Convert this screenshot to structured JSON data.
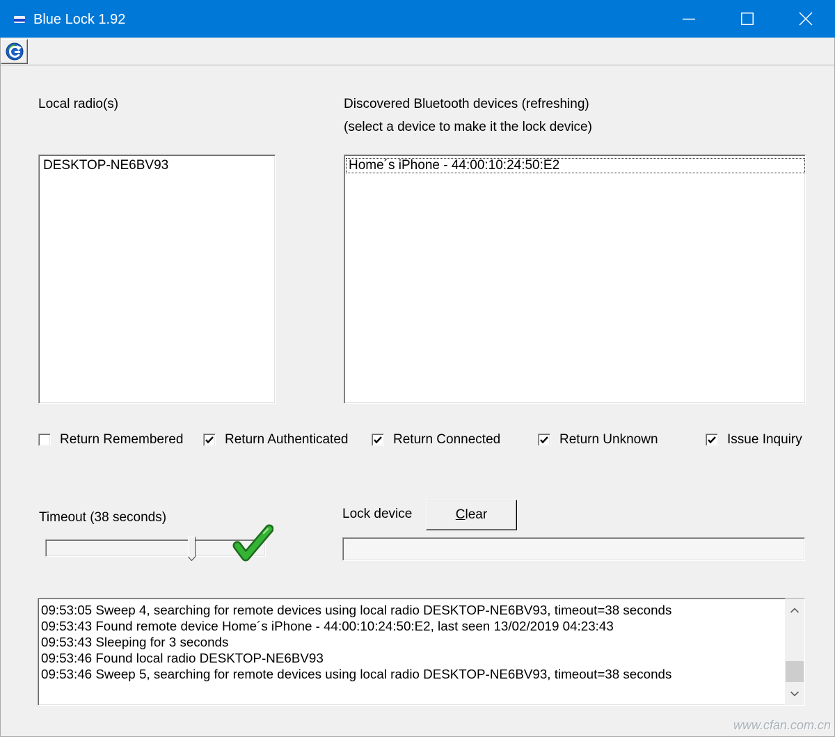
{
  "window": {
    "title": "Blue Lock 1.92",
    "app_icon": "app-icon",
    "controls": [
      "minimize-icon",
      "maximize-icon",
      "close-icon"
    ]
  },
  "toolbar": {
    "button_icon": "refresh-globe-icon"
  },
  "local_radios": {
    "label": "Local radio(s)",
    "items": [
      "DESKTOP-NE6BV93"
    ]
  },
  "discovered_devices": {
    "label": "Discovered Bluetooth devices (refreshing)",
    "hint": "(select a device to make it the lock device)",
    "items": [
      "Home´s iPhone - 44:00:10:24:50:E2"
    ],
    "focused_index": 0
  },
  "options": [
    {
      "label": "Return Remembered",
      "checked": false
    },
    {
      "label": "Return Authenticated",
      "checked": true
    },
    {
      "label": "Return Connected",
      "checked": true
    },
    {
      "label": "Return Unknown",
      "checked": true
    },
    {
      "label": "Issue Inquiry",
      "checked": true
    }
  ],
  "timeout": {
    "label": "Timeout (38 seconds)",
    "slider_level": 0.67
  },
  "lock_device": {
    "label": "Lock device",
    "clear_button": "Clear"
  },
  "log": {
    "lines": [
      "09:53:05 Sweep 4, searching for remote devices using local radio DESKTOP-NE6BV93, timeout=38 seconds",
      "09:53:43 Found remote device Home´s iPhone - 44:00:10:24:50:E2, last seen 13/02/2019 04:23:43",
      "09:53:43 Sleeping for 3 seconds",
      "09:53:46 Found local radio DESKTOP-NE6BV93",
      "09:53:46 Sweep 5, searching for remote devices using local radio DESKTOP-NE6BV93, timeout=38 seconds"
    ],
    "scroll_position": 1
  },
  "annotation": {
    "icon": "green-check-icon"
  },
  "watermark": "www.cfan.com.cn",
  "colors": {
    "title_bar": "#0078d7",
    "dialog_background": "#f0f0f0",
    "annotation_check": "#35b335"
  }
}
